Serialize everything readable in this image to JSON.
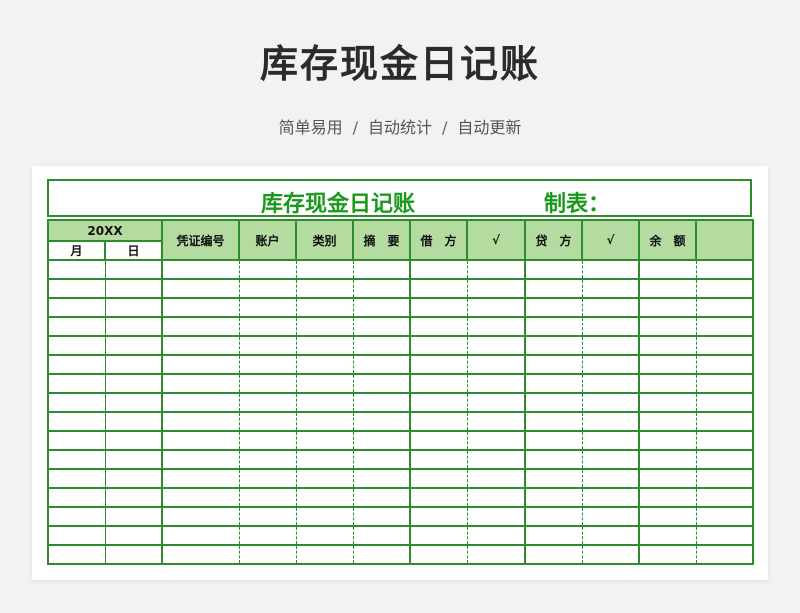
{
  "header": {
    "title": "库存现金日记账",
    "subtitle_items": [
      "简单易用",
      "自动统计",
      "自动更新"
    ],
    "separator": "/"
  },
  "sheet": {
    "title": "库存现金日记账",
    "maker_label": "制表：",
    "year_label": "20XX",
    "columns": [
      "凭证编号",
      "账户",
      "类别",
      "摘　要",
      "借　方",
      "√",
      "贷　方",
      "√",
      "余　额",
      ""
    ],
    "subheaders": [
      "月",
      "日"
    ],
    "empty_rows": 16
  },
  "colors": {
    "accent": "#2e8b2e",
    "title_green": "#1a9a1a",
    "header_fill": "#b5dca0"
  }
}
